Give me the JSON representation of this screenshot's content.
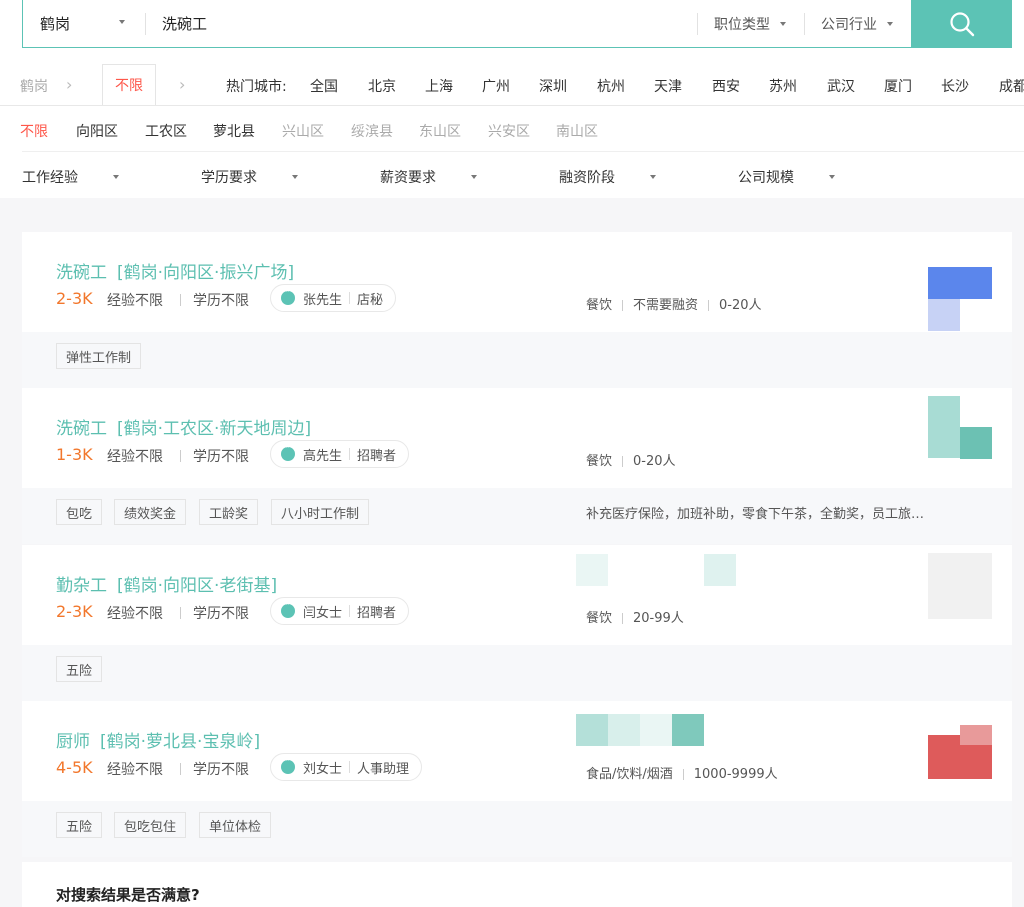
{
  "search": {
    "city": "鹤岗",
    "keyword": "洗碗工",
    "job_type": "职位类型",
    "industry": "公司行业",
    "search_icon": "search-icon"
  },
  "cityrow": {
    "current_city": "鹤岗",
    "tab": "不限",
    "hot_label": "热门城市:",
    "cities": [
      "全国",
      "北京",
      "上海",
      "广州",
      "深圳",
      "杭州",
      "天津",
      "西安",
      "苏州",
      "武汉",
      "厦门",
      "长沙",
      "成都"
    ]
  },
  "districts": [
    "不限",
    "向阳区",
    "工农区",
    "萝北县",
    "兴山区",
    "绥滨县",
    "东山区",
    "兴安区",
    "南山区"
  ],
  "filters": [
    "工作经验",
    "学历要求",
    "薪资要求",
    "融资阶段",
    "公司规模"
  ],
  "jobs": [
    {
      "title": "洗碗工",
      "location": "[鹤岗·向阳区·振兴广场]",
      "salary": "2-3K",
      "experience": "经验不限",
      "education": "学历不限",
      "contact_name": "张先生",
      "contact_role": "店秘",
      "industry": "餐饮",
      "funding": "不需要融资",
      "size": "0-20人",
      "tags": [
        "弹性工作制"
      ],
      "welfare": "",
      "logo_colors": [
        "#5b86ec",
        "#c7d2f5"
      ]
    },
    {
      "title": "洗碗工",
      "location": "[鹤岗·工农区·新天地周边]",
      "salary": "1-3K",
      "experience": "经验不限",
      "education": "学历不限",
      "contact_name": "高先生",
      "contact_role": "招聘者",
      "industry": "餐饮",
      "funding": "",
      "size": "0-20人",
      "tags": [
        "包吃",
        "绩效奖金",
        "工龄奖",
        "八小时工作制"
      ],
      "welfare": "补充医疗保险，加班补助，零食下午茶，全勤奖，员工旅…",
      "logo_colors": [
        "#a8dcd4",
        "#6cc1b3"
      ]
    },
    {
      "title": "勤杂工",
      "location": "[鹤岗·向阳区·老街基]",
      "salary": "2-3K",
      "experience": "经验不限",
      "education": "学历不限",
      "contact_name": "闫女士",
      "contact_role": "招聘者",
      "industry": "餐饮",
      "funding": "",
      "size": "20-99人",
      "tags": [
        "五险"
      ],
      "welfare": "",
      "logo_colors": [
        "#ececec",
        "#f4f4f4"
      ]
    },
    {
      "title": "厨师",
      "location": "[鹤岗·萝北县·宝泉岭]",
      "salary": "4-5K",
      "experience": "经验不限",
      "education": "学历不限",
      "contact_name": "刘女士",
      "contact_role": "人事助理",
      "industry": "食品/饮料/烟酒",
      "funding": "",
      "size": "1000-9999人",
      "tags": [
        "五险",
        "包吃包住",
        "单位体检"
      ],
      "welfare": "",
      "logo_colors": [
        "#de5b5b",
        "#e89a9a"
      ]
    }
  ],
  "feedback": {
    "question": "对搜索结果是否满意?"
  },
  "colors": {
    "accent": "#5cc3b5",
    "salary": "#f2772c",
    "active": "#fe574a"
  }
}
